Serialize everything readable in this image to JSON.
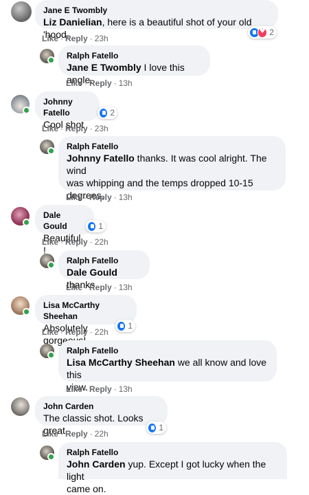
{
  "actions": {
    "like": "Like",
    "reply": "Reply",
    "dot": "·"
  },
  "comments": [
    {
      "author": "Jane E Twombly",
      "tag": "Liz Danielian",
      "text": ", here is a beautiful shot of your old 'hood.",
      "time": "23h",
      "reactions": {
        "types": [
          "like-icon",
          "love-icon"
        ],
        "count": "2"
      }
    },
    {
      "author": "Ralph Fatello",
      "tag": "Jane E Twombly",
      "text": " I love this angle.",
      "time": "13h"
    },
    {
      "author": "Johnny Fatello",
      "text": "Cool shot",
      "time": "23h",
      "reactions": {
        "types": [
          "like-icon"
        ],
        "count": "2"
      }
    },
    {
      "author": "Ralph Fatello",
      "tag": "Johnny Fatello",
      "text_line1": " thanks. It was cool alright. The wind",
      "text_line2": "was whipping and the temps dropped 10-15",
      "text_line3": "degrees.",
      "time": "13h"
    },
    {
      "author": "Dale Gould",
      "text": "Beautiful !",
      "time": "22h",
      "reactions": {
        "types": [
          "like-icon"
        ],
        "count": "1"
      }
    },
    {
      "author": "Ralph Fatello",
      "tag": "Dale Gould",
      "text": " thanks",
      "time": "13h"
    },
    {
      "author": "Lisa McCarthy Sheehan",
      "text": "Absolutely gorgeous!",
      "time": "22h",
      "reactions": {
        "types": [
          "like-icon"
        ],
        "count": "1"
      }
    },
    {
      "author": "Ralph Fatello",
      "tag": "Lisa McCarthy Sheehan",
      "text_line1": " we all know and love this",
      "text_line2": "view.",
      "time": "13h"
    },
    {
      "author": "John Carden",
      "text": "The classic shot. Looks great.",
      "time": "22h",
      "reactions": {
        "types": [
          "like-icon"
        ],
        "count": "1"
      }
    },
    {
      "author": "Ralph Fatello",
      "tag": "John Carden",
      "text_line1": " yup. Except I got lucky when the light",
      "text_line2": "came on.",
      "time": ""
    }
  ]
}
